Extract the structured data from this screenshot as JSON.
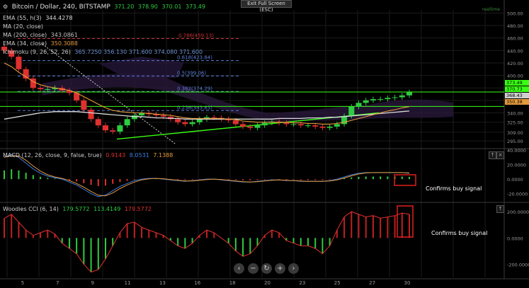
{
  "header": {
    "symbol": "Bitcoin / Dollar, 240, BITSTAMP",
    "ohlc": [
      "371.20",
      "378.90",
      "370.01",
      "373.49"
    ],
    "tooltip": "Exit Full Screen (ESC)",
    "realtime": "realtime"
  },
  "legend": [
    {
      "label": "EMA (55, h(3)",
      "value": "344.4278",
      "color": "#d9d9d9"
    },
    {
      "label": "MA (20, close)",
      "value": "",
      "color": "#d9d9d9"
    },
    {
      "label": "MA (200, close)",
      "value": "343.0861",
      "color": "#bfbfbf"
    },
    {
      "label": "EMA (34, close)",
      "value": "350.3088",
      "color": "#e59a3c"
    },
    {
      "label": "Ichimoku (9, 26, 52, 26)",
      "value": "365.7250   356.130   371.600   374.080   371.600",
      "color": "#6a8fd0"
    }
  ],
  "colors": {
    "bg": "#000000",
    "up": "#2ecc40",
    "down": "#e03030",
    "grid": "#1b1b1b",
    "fib": "#5b7fd6",
    "fib786": "#cc3030",
    "trend": "#39ff14",
    "cloud": "#2a1a3e"
  },
  "axes": {
    "x_ticks": [
      "5",
      "7",
      "9",
      "11",
      "13",
      "16",
      "18",
      "20",
      "23",
      "25",
      "27",
      "30"
    ],
    "price_ticks": [
      "500.00",
      "480.00",
      "460.00",
      "440.00",
      "420.00",
      "400.00",
      "380.00",
      "360.00",
      "340.00",
      "325.00",
      "309.00",
      "295.00"
    ],
    "price_tags": [
      {
        "text": "373.49",
        "color": "#39ff14"
      },
      {
        "text": "370.73",
        "color": "#39ff14"
      },
      {
        "text": "368.43",
        "color": "#cfcfcf"
      },
      {
        "text": "350.38",
        "color": "#e59a3c"
      }
    ],
    "macd_ticks": [
      "40.0000",
      "20.0000",
      "0.0000",
      "-20.0000"
    ],
    "cci_ticks": [
      "200.0000",
      "0.0000",
      "-200.0000"
    ]
  },
  "fib_levels": [
    {
      "label": "0.786(459.13)",
      "price": 459.13
    },
    {
      "label": "0.618(423.84)",
      "price": 423.84
    },
    {
      "label": "0.5(399.06)",
      "price": 399.06
    },
    {
      "label": "0.382(374.29)",
      "price": 374.29
    },
    {
      "label": "0.236(343.63)",
      "price": 343.63
    }
  ],
  "macd": {
    "label": "MACD (12, 26, close, 9, false, true)",
    "values": [
      "0.9143",
      "8.0531",
      "7.1388"
    ],
    "note": "Confirms buy signal"
  },
  "cci": {
    "label": "Woodies CCI (6, 14)",
    "values": [
      "179.5772",
      "113.4149",
      "179.5772"
    ],
    "note": "Confirms buy signal"
  },
  "nav": [
    "‹",
    "−",
    "↻",
    "+",
    "›"
  ],
  "chart_data": {
    "type": "candlestick",
    "title": "Bitcoin / Dollar, 240, BITSTAMP",
    "x_categories": [
      "5",
      "7",
      "9",
      "11",
      "13",
      "16",
      "18",
      "20",
      "23",
      "25",
      "27",
      "30"
    ],
    "price_range": [
      285,
      505
    ],
    "close": [
      440,
      430,
      410,
      395,
      380,
      378,
      378,
      380,
      376,
      372,
      360,
      345,
      330,
      320,
      312,
      310,
      320,
      330,
      336,
      340,
      338,
      336,
      334,
      330,
      325,
      322,
      325,
      330,
      333,
      332,
      330,
      328,
      322,
      318,
      316,
      320,
      324,
      326,
      324,
      322,
      322,
      320,
      320,
      318,
      316,
      318,
      322,
      335,
      350,
      356,
      360,
      362,
      362,
      364,
      365,
      368,
      373
    ],
    "ema34": [
      420,
      414,
      405,
      398,
      390,
      385,
      382,
      380,
      378,
      376,
      372,
      366,
      360,
      354,
      348,
      344,
      342,
      341,
      340,
      340,
      339,
      338,
      337,
      336,
      334,
      332,
      331,
      331,
      331,
      331,
      331,
      330,
      329,
      327,
      326,
      325,
      325,
      325,
      325,
      325,
      324,
      324,
      323,
      323,
      322,
      322,
      323,
      325,
      328,
      331,
      334,
      337,
      340,
      343,
      345,
      348,
      350
    ],
    "ma200": [
      330,
      332,
      334,
      336,
      338,
      340,
      341,
      342,
      342,
      342,
      342,
      341,
      340,
      339,
      338,
      337,
      336,
      335,
      334,
      334,
      333,
      332,
      332,
      331,
      331,
      330,
      330,
      330,
      330,
      330,
      330,
      330,
      330,
      330,
      330,
      330,
      330,
      330,
      331,
      331,
      331,
      331,
      332,
      332,
      332,
      333,
      333,
      334,
      335,
      336,
      337,
      338,
      339,
      340,
      341,
      342,
      343
    ],
    "macd": [
      30,
      34,
      30,
      22,
      14,
      8,
      4,
      2,
      0,
      -4,
      -8,
      -14,
      -20,
      -24,
      -22,
      -16,
      -10,
      -6,
      -2,
      0,
      1,
      1,
      0,
      -1,
      -2,
      -3,
      -2,
      -1,
      0,
      0,
      -1,
      -2,
      -3,
      -4,
      -4,
      -3,
      -2,
      -1,
      -1,
      -2,
      -2,
      -3,
      -3,
      -3,
      -3,
      -2,
      0,
      3,
      6,
      8,
      9,
      9,
      9,
      9,
      9,
      9,
      8
    ],
    "cci": [
      150,
      180,
      120,
      60,
      20,
      40,
      60,
      30,
      -40,
      -80,
      -120,
      -200,
      -260,
      -240,
      -160,
      -60,
      40,
      110,
      120,
      80,
      60,
      40,
      20,
      -20,
      -60,
      -80,
      -40,
      20,
      60,
      40,
      0,
      -40,
      -100,
      -140,
      -120,
      -60,
      20,
      60,
      40,
      -20,
      -40,
      -60,
      -60,
      -80,
      -120,
      -60,
      60,
      160,
      200,
      180,
      160,
      170,
      150,
      160,
      170,
      190,
      180
    ]
  }
}
